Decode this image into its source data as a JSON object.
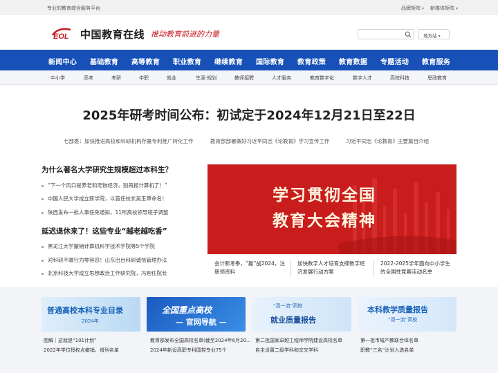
{
  "topbar": {
    "tagline": "专业的教育综合服务平台",
    "links": [
      "品牌矩阵",
      "新媒体矩阵"
    ]
  },
  "header": {
    "logo_mark": "EOL",
    "logo_text": "中国教育在线",
    "slogan": "推动教育前进的力量",
    "search_placeholder": "",
    "region_label": "地方站"
  },
  "mainnav": [
    "新闻中心",
    "基础教育",
    "高等教育",
    "职业教育",
    "继续教育",
    "国际教育",
    "教育政策",
    "教育数据",
    "专题活动",
    "教育服务"
  ],
  "subnav": [
    "中小学",
    "高考",
    "考研",
    "中职",
    "就业",
    "生涯·规划",
    "教师招聘",
    "人才服务",
    "教育数字化",
    "数字人才",
    "高校科技",
    "思政教育"
  ],
  "headline": "2025年研考时间公布：初试定于2024年12月21日至22日",
  "subheads": [
    "七部委：加快推进高校和科研机构存量专利推广转化工作",
    "教育部部署做好习近平同志《论教育》学习宣传工作",
    "习近平同志《论教育》主要篇目介绍"
  ],
  "left": {
    "heading1": "为什么著名大学研究生规模超过本科生？",
    "list1": [
      "“下一个风口是养老和宠物经济，别再报计算机了！”",
      "中国人民大学成立新学院，以首任校长吴玉章命名！",
      "陕西发布一批人事任免通知，11所高校领导班子调整"
    ],
    "heading2": "延迟退休来了！这些专业“越老越吃香”",
    "list2": [
      "黑龙江大学撤销计算机科学技术学院等5个学院",
      "对科研不端行为零容忍！山东出台科研诚信管理办法",
      "北京科技大学成立思想政治工作研究院，冯刚任院长"
    ]
  },
  "banner": {
    "line1": "学习贯彻全国",
    "line2": "教育大会精神"
  },
  "captions": [
    "会计新考季，“赢”战2024，注册领资料",
    "加快数字人才培育支撑数字经济发展行动方案",
    "2022-2025学年面向中小学生的全国性竞赛活动名单"
  ],
  "cards": [
    {
      "title": "普通高校本科专业目录",
      "sub": "2024年",
      "line1": "图解｜这就是“101计划”",
      "line2": "2022年学位授权点撤销、增列名单"
    },
    {
      "title": "全国重点高校",
      "sub": "— 官网导航 —",
      "line1": "教育部发布全国高校名单(截至2024年6月20...",
      "line2": "2024年新设高职专科国控专业75个"
    },
    {
      "title": "就业质量报告",
      "sub": "“双一流”高校",
      "line1": "第二批国家卓越工程师学院建设高校名单",
      "line2": "自主设置二级学科和交叉学科"
    },
    {
      "title": "本科教学质量报告",
      "sub": "“双一流”高校",
      "line1": "第一批市域产教联合体名单",
      "line2": "职教“三名”计划入选名单"
    }
  ],
  "colors": {
    "nav_blue": "#1751b7",
    "brand_red": "#c8161d"
  }
}
